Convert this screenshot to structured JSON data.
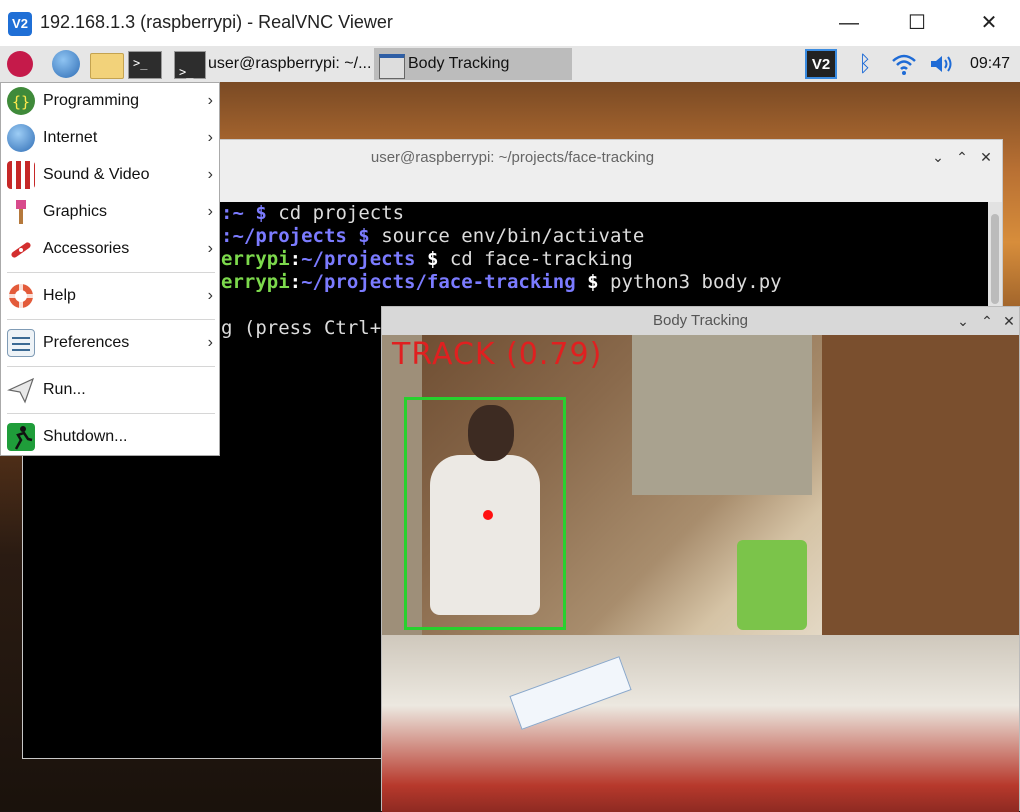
{
  "vnc": {
    "logo": "V2",
    "title": "192.168.1.3 (raspberrypi) - RealVNC Viewer",
    "minimize": "—",
    "maximize": "☐",
    "close": "✕"
  },
  "taskbar": {
    "icons": [
      "raspberry-icon",
      "web-browser-icon",
      "file-manager-icon",
      "terminal-icon"
    ],
    "tasks": [
      {
        "label": "user@raspberrypi: ~/...",
        "icon": "terminal-icon"
      },
      {
        "label": "Body Tracking",
        "icon": "window-icon",
        "active": true
      }
    ],
    "tray": {
      "vnc_label": "V2",
      "bluetooth_glyph": "ᛒ",
      "wifi_glyph": "((•))",
      "volume_glyph": "◀))",
      "clock": "09:47"
    }
  },
  "start_menu": {
    "items": [
      {
        "label": "Programming",
        "icon": "programming-icon",
        "submenu": true
      },
      {
        "label": "Internet",
        "icon": "internet-icon",
        "submenu": true
      },
      {
        "label": "Sound & Video",
        "icon": "sound-video-icon",
        "submenu": true
      },
      {
        "label": "Graphics",
        "icon": "graphics-icon",
        "submenu": true
      },
      {
        "label": "Accessories",
        "icon": "accessories-icon",
        "submenu": true
      },
      {
        "label": "Help",
        "icon": "help-icon",
        "submenu": true
      },
      {
        "label": "Preferences",
        "icon": "preferences-icon",
        "submenu": true
      },
      {
        "label": "Run...",
        "icon": "run-icon",
        "submenu": false
      },
      {
        "label": "Shutdown...",
        "icon": "shutdown-icon",
        "submenu": false
      }
    ],
    "arrow": "›"
  },
  "terminal": {
    "title": "user@raspberrypi: ~/projects/face-tracking",
    "controls": {
      "minimize": "⌄",
      "maximize": "⌃",
      "close": "✕"
    },
    "lines": [
      {
        "prompt_user": "",
        "sep": ":",
        "path": "~",
        "dollar": "$",
        "cmd": "cd projects"
      },
      {
        "prompt_user": "",
        "sep": ":",
        "path": "~/projects",
        "dollar": "$",
        "cmd": "source env/bin/activate"
      },
      {
        "prompt_user": "errypi",
        "sep": ":",
        "path": "~/projects",
        "dollar": "$",
        "cmd": "cd face-tracking"
      },
      {
        "prompt_user": "errypi",
        "sep": ":",
        "path": "~/projects/face-tracking",
        "dollar": "$",
        "cmd": "python3 body.py"
      }
    ],
    "output_line": "g (press Ctrl+"
  },
  "body_tracking": {
    "title": "Body Tracking",
    "controls": {
      "minimize": "⌄",
      "maximize": "⌃",
      "close": "✕"
    },
    "track_label": "TRACK (0.79)"
  },
  "colors": {
    "prompt_green": "#7cd94c",
    "path_blue": "#7b7bff",
    "track_red": "#e02020",
    "box_green": "#27d12e"
  }
}
